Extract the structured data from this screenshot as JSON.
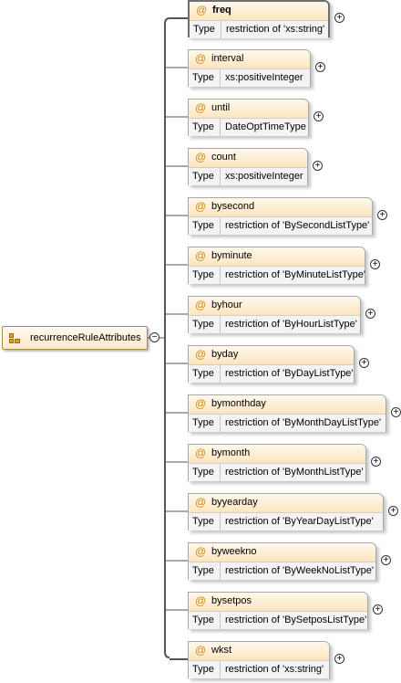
{
  "group": {
    "label": "recurrenceRuleAttributes",
    "icon": "attribute-group-icon",
    "collapse_symbol": "−"
  },
  "type_label": "Type",
  "attribute_symbol": "@",
  "expand_symbol": "+",
  "attributes": [
    {
      "name": "freq",
      "type": "restriction of 'xs:string'",
      "selected": true
    },
    {
      "name": "interval",
      "type": "xs:positiveInteger"
    },
    {
      "name": "until",
      "type": "DateOptTimeType"
    },
    {
      "name": "count",
      "type": "xs:positiveInteger"
    },
    {
      "name": "bysecond",
      "type": "restriction of 'BySecondListType'"
    },
    {
      "name": "byminute",
      "type": "restriction of 'ByMinuteListType'"
    },
    {
      "name": "byhour",
      "type": "restriction of 'ByHourListType'"
    },
    {
      "name": "byday",
      "type": "restriction of 'ByDayListType'"
    },
    {
      "name": "bymonthday",
      "type": "restriction of 'ByMonthDayListType'"
    },
    {
      "name": "bymonth",
      "type": "restriction of 'ByMonthListType'"
    },
    {
      "name": "byyearday",
      "type": "restriction of 'ByYearDayListType'"
    },
    {
      "name": "byweekno",
      "type": "restriction of 'ByWeekNoListType'"
    },
    {
      "name": "bysetpos",
      "type": "restriction of 'BySetposListType'"
    },
    {
      "name": "wkst",
      "type": "restriction of 'xs:string'"
    }
  ]
}
